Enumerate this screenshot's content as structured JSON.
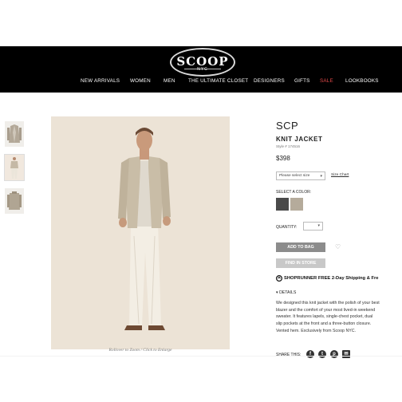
{
  "brand": {
    "logo": "SCOOP",
    "logo_sub": "NYC"
  },
  "nav": {
    "items": [
      "NEW ARRIVALS",
      "WOMEN",
      "MEN",
      "THE ULTIMATE CLOSET",
      "DESIGNERS",
      "GIFTS",
      "SALE",
      "LOOKBOOKS"
    ]
  },
  "product": {
    "designer": "SCP",
    "name": "KNIT JACKET",
    "style": "Style # 174516",
    "price": "$398",
    "size_placeholder": "Please select size",
    "size_chart": "Size Chart",
    "color_label": "SELECT A COLOR:",
    "colors": [
      "#4a4a4a",
      "#b5ab9b"
    ],
    "quantity_label": "QUANTITY:",
    "add_to_bag": "ADD TO BAG",
    "find_in_store": "FIND IN STORE",
    "shoprunner": "SHOPRUNNER FREE 2-Day Shipping & Fre",
    "details_label": "DETAILS",
    "details_text": "We designed this knit jacket with the polish of your best blazer and the comfort of your most lived-in weekend sweater. It features lapels, single-chest pocket, dual slip pockets at the front and a three-button closure. Vented hem. Exclusively from Scoop NYC.",
    "share_label": "SHARE THIS:",
    "image_caption": "Rollover to Zoom / Click to Enlarge"
  },
  "icons": {
    "dropdown": "▾",
    "details_toggle": "▾",
    "wishlist": "♡",
    "social": [
      "f",
      "t",
      "p",
      "✉"
    ]
  }
}
